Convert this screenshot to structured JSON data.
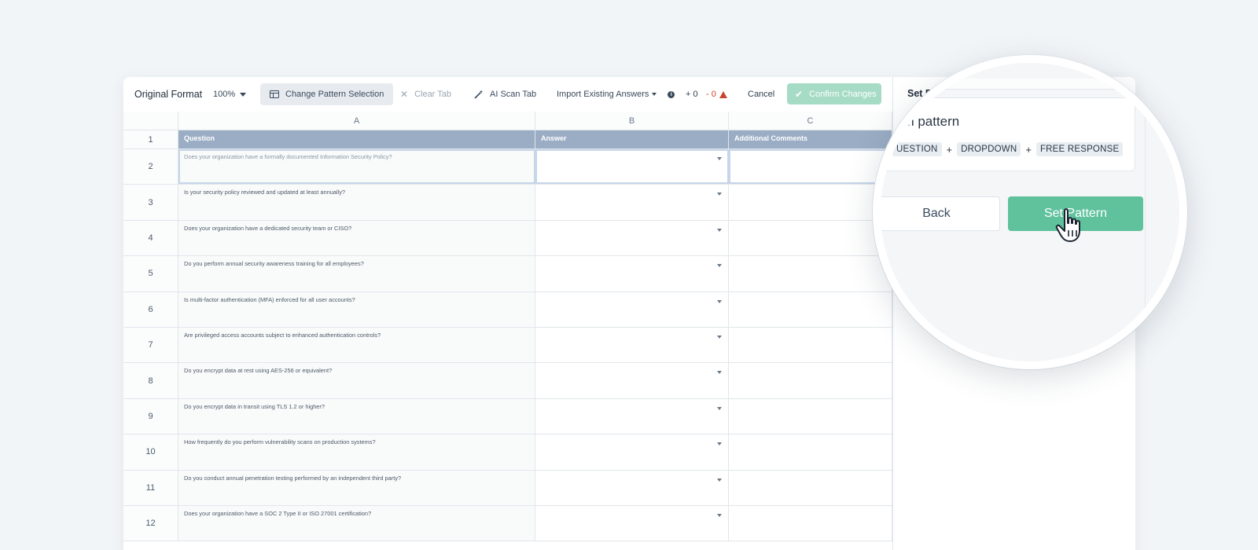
{
  "toolbar": {
    "title": "Original Format",
    "zoom": "100%",
    "change_pattern": "Change Pattern Selection",
    "clear_tab": "Clear Tab",
    "ai_scan": "AI Scan Tab",
    "import_answers": "Import Existing Answers",
    "added_count": "+ 0",
    "removed_count": "- 0",
    "cancel": "Cancel",
    "confirm": "Confirm Changes"
  },
  "columns": [
    "A",
    "B",
    "C"
  ],
  "header_row": {
    "num": "1",
    "a": "Question",
    "b": "Answer",
    "c": "Additional Comments"
  },
  "rows": [
    {
      "num": "2",
      "q": "Does your organization have a formally documented Information Security Policy?"
    },
    {
      "num": "3",
      "q": "Is your security policy reviewed and updated at least annually?"
    },
    {
      "num": "4",
      "q": "Does your organization have a dedicated security team or CISO?"
    },
    {
      "num": "5",
      "q": "Do you perform annual security awareness training for all employees?"
    },
    {
      "num": "6",
      "q": "Is multi-factor authentication (MFA) enforced for all user accounts?"
    },
    {
      "num": "7",
      "q": "Are privileged access accounts subject to enhanced authentication controls?"
    },
    {
      "num": "8",
      "q": "Do you encrypt data at rest using AES-256 or equivalent?"
    },
    {
      "num": "9",
      "q": "Do you encrypt data in transit using TLS 1.2 or higher?"
    },
    {
      "num": "10",
      "q": "How frequently do you perform vulnerability scans on production systems?"
    },
    {
      "num": "11",
      "q": "Do you conduct annual penetration testing performed by an independent third party?"
    },
    {
      "num": "12",
      "q": "Does your organization have a SOC 2 Type II or ISO 27001 certification?"
    }
  ],
  "panel": {
    "title": "Set P",
    "heading": "irm pattern",
    "chips": [
      "UESTION",
      "DROPDOWN",
      "FREE RESPONSE"
    ],
    "plus": "+",
    "back": "Back",
    "set_pattern": "Set Pattern"
  },
  "colors": {
    "accent": "#5fc29d",
    "confirm_disabled": "#a6dcc5",
    "header_fill": "#9aadc4",
    "warning": "#c9452f"
  }
}
